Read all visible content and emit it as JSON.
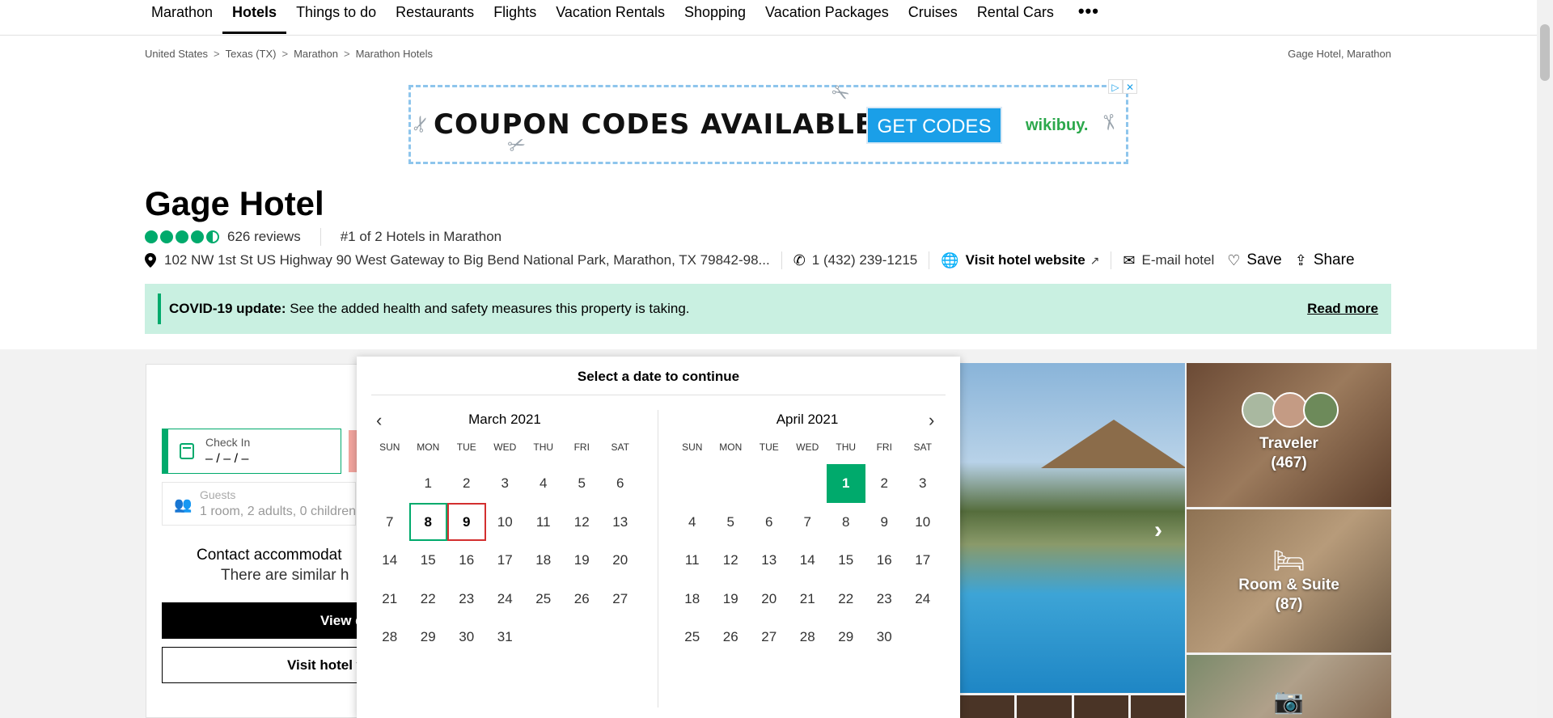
{
  "nav": {
    "items": [
      "Marathon",
      "Hotels",
      "Things to do",
      "Restaurants",
      "Flights",
      "Vacation Rentals",
      "Shopping",
      "Vacation Packages",
      "Cruises",
      "Rental Cars"
    ],
    "active": "Hotels",
    "more": "•••"
  },
  "breadcrumb": {
    "items": [
      "United States",
      "Texas (TX)",
      "Marathon",
      "Marathon Hotels"
    ],
    "separator": ">",
    "current": "Gage Hotel, Marathon"
  },
  "ad": {
    "headline": "COUPON CODES AVAILABLE",
    "cta": "GET CODES",
    "brand": "wikibuy.",
    "adchoices": [
      "▷",
      "✕"
    ]
  },
  "hotel": {
    "name": "Gage Hotel",
    "rating": 4.5,
    "reviews": "626 reviews",
    "rank": "#1 of 2 Hotels in Marathon",
    "address": "102 NW 1st St US Highway 90 West Gateway to Big Bend National Park, Marathon, TX 79842-98...",
    "phone": "1 (432) 239-1215",
    "website_label": "Visit hotel website",
    "email_label": "E-mail hotel",
    "save_label": "Save",
    "share_label": "Share"
  },
  "covid": {
    "title": "COVID-19 update:",
    "text": "See the added health and safety measures this property is taking.",
    "link": "Read more"
  },
  "booking": {
    "checkin_label": "Check In",
    "checkin_value": "– / – / –",
    "guests_label": "Guests",
    "guests_value": "1 room, 2 adults, 0 children",
    "contact_text": "Contact accommodat",
    "similar_text": "There are similar h",
    "view_button": "View d",
    "visit_button": "Visit hotel w"
  },
  "calendar": {
    "title": "Select a date to continue",
    "weekdays": [
      "SUN",
      "MON",
      "TUE",
      "WED",
      "THU",
      "FRI",
      "SAT"
    ],
    "months": [
      {
        "name": "March 2021",
        "offset": 1,
        "days": 31,
        "selected_start": 8,
        "selected_end": 9,
        "highlight": null
      },
      {
        "name": "April 2021",
        "offset": 4,
        "days": 30,
        "selected_start": null,
        "selected_end": null,
        "highlight": 1
      }
    ]
  },
  "photos": {
    "tiles": [
      {
        "label": "Traveler",
        "count": "(467)"
      },
      {
        "label": "Room & Suite",
        "count": "(87)"
      }
    ]
  },
  "colors": {
    "accent": "#00aa6c",
    "covid_bg": "#c9f0e1",
    "end_date_border": "#d32f2f",
    "ad_button": "#1a9fe8"
  }
}
